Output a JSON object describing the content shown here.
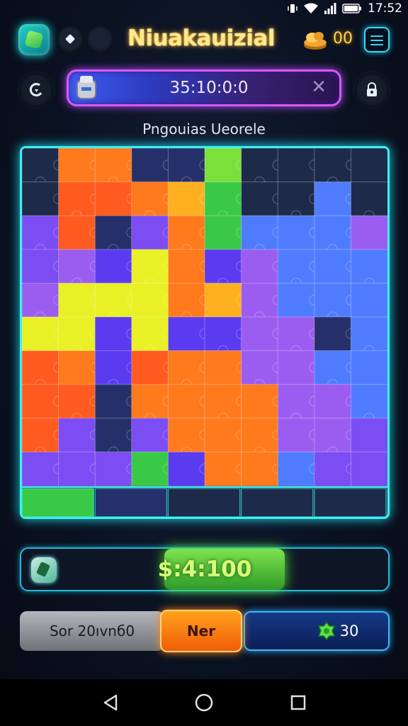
{
  "status_bar": {
    "time": "17:52"
  },
  "header": {
    "title": "Niuakauizial",
    "coins": "00"
  },
  "timer": {
    "value": "35:10:0:0",
    "close_glyph": "✕"
  },
  "puzzle_name": "Pngouias Ueorele",
  "progress": {
    "value_text": "$:4:100"
  },
  "actions": {
    "left_label": "Sor 20ıvnб0",
    "middle_label": "Ner",
    "right_value": "30"
  },
  "icons": {
    "back": "back-arrow-icon",
    "lock": "lock-icon",
    "coin": "coin-stack-icon",
    "menu": "hamburger-menu-icon",
    "gem": "green-gem-icon",
    "timer": "canister-icon"
  },
  "colors": {
    "accent_cyan": "#3df0f0",
    "accent_purple": "#d25cf0",
    "title_gold": "#ffe98a",
    "progress_green": "#55e03a",
    "button_orange": "#ff8a16",
    "button_blue": "#2aa6ff"
  },
  "board": {
    "palette": [
      "#ff5a1f",
      "#ff7a1c",
      "#ffb020",
      "#e9f025",
      "#7be03a",
      "#39c947",
      "#5b3bf0",
      "#7b4df2",
      "#9b5df0",
      "#4f7cff",
      "#25306a",
      "#1e2a4a"
    ],
    "grid": [
      [
        11,
        1,
        1,
        10,
        10,
        4,
        11,
        11,
        11,
        11
      ],
      [
        11,
        0,
        0,
        1,
        2,
        5,
        11,
        11,
        9,
        11
      ],
      [
        7,
        0,
        10,
        7,
        1,
        5,
        9,
        9,
        9,
        8
      ],
      [
        7,
        8,
        6,
        3,
        1,
        6,
        8,
        9,
        9,
        9
      ],
      [
        8,
        3,
        3,
        3,
        1,
        2,
        8,
        9,
        9,
        9
      ],
      [
        3,
        3,
        6,
        3,
        6,
        6,
        8,
        8,
        10,
        9
      ],
      [
        0,
        1,
        6,
        0,
        1,
        1,
        8,
        8,
        9,
        9
      ],
      [
        0,
        0,
        10,
        1,
        1,
        1,
        1,
        8,
        8,
        9
      ],
      [
        0,
        7,
        10,
        7,
        1,
        1,
        1,
        8,
        8,
        7
      ],
      [
        7,
        7,
        7,
        5,
        6,
        1,
        1,
        9,
        7,
        7
      ]
    ],
    "bottom_strip": [
      5,
      10,
      11,
      11,
      11
    ]
  }
}
